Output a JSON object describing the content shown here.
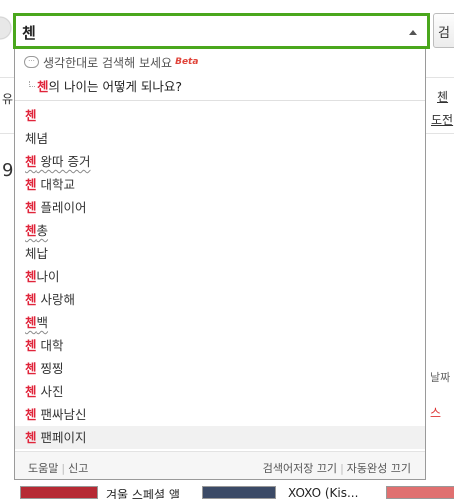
{
  "search": {
    "query": "첸"
  },
  "panel": {
    "smart_hint": "생각한대로 검색해 보세요",
    "beta_label": "Beta",
    "question": {
      "keyword": "첸",
      "rest": "의 나이는 어떻게 되나요?"
    },
    "suggestions": [
      {
        "kw": "첸",
        "rest": "",
        "squiggle": false
      },
      {
        "kw": "",
        "rest": "체념",
        "squiggle": false
      },
      {
        "kw": "첸",
        "rest": " 왕따 증거",
        "squiggle": true
      },
      {
        "kw": "첸",
        "rest": " 대학교",
        "squiggle": false
      },
      {
        "kw": "첸",
        "rest": " 플레이어",
        "squiggle": false
      },
      {
        "kw": "첸",
        "rest": "총",
        "squiggle": true
      },
      {
        "kw": "",
        "rest": "체납",
        "squiggle": false
      },
      {
        "kw": "첸",
        "rest": "나이",
        "squiggle": false
      },
      {
        "kw": "첸",
        "rest": " 사랑해",
        "squiggle": false
      },
      {
        "kw": "첸",
        "rest": "백",
        "squiggle": true
      },
      {
        "kw": "첸",
        "rest": " 대학",
        "squiggle": false
      },
      {
        "kw": "첸",
        "rest": " 찡찡",
        "squiggle": false
      },
      {
        "kw": "첸",
        "rest": " 사진",
        "squiggle": false
      },
      {
        "kw": "첸",
        "rest": " 팬싸남신",
        "squiggle": false
      },
      {
        "kw": "첸",
        "rest": " 팬페이지",
        "squiggle": false
      }
    ],
    "active_index": 14,
    "footer": {
      "help": "도움말",
      "report": "신고",
      "stop_history": "검색어저장 끄기",
      "stop_autocomplete": "자동완성 끄기"
    }
  },
  "background": {
    "search_button": "검",
    "left_peek_1": "유",
    "left_peek_2": "9",
    "right_link_1": "첸",
    "right_link_2": "도전",
    "right_peek_1": "날짜",
    "right_peek_2": "스",
    "bottom_item_1": "겨울 스페셜 앨",
    "bottom_item_2": "XOXO (Kis..."
  },
  "colors": {
    "search_border": "#4aa71c",
    "highlight": "#e0243a"
  }
}
